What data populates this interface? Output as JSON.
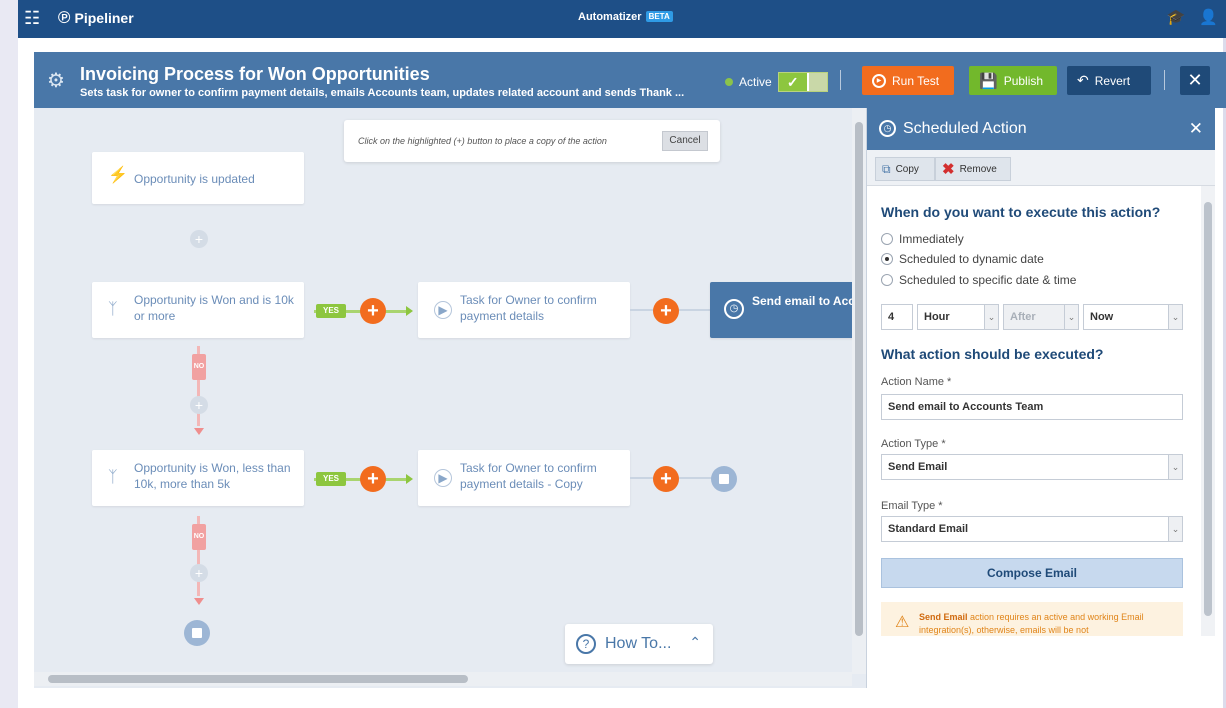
{
  "topbar": {
    "app_name": "Pipeliner",
    "module": "Automatizer",
    "beta_badge": "BETA"
  },
  "process": {
    "title": "Invoicing Process for Won Opportunities",
    "subtitle": "Sets task for owner to confirm payment details, emails Accounts team, updates related account and sends Thank ...",
    "status_label": "Active",
    "is_active": true,
    "run_test_label": "Run Test",
    "publish_label": "Publish",
    "revert_label": "Revert"
  },
  "canvas": {
    "hint_text": "Click on the highlighted (+) button to place a copy of the action",
    "cancel_label": "Cancel",
    "trigger_label": "Opportunity is updated",
    "yes_label": "YES",
    "no_label": "NO",
    "condition1_label": "Opportunity is Won and is 10k or more",
    "action1_label": "Task for Owner to confirm payment details",
    "action2_label": "Send email to Accounts Team",
    "condition2_label": "Opportunity is Won, less than 10k, more than 5k",
    "action3_label": "Task for Owner to confirm payment details - Copy",
    "howto_label": "How To..."
  },
  "panel": {
    "title": "Scheduled Action",
    "copy_label": "Copy",
    "remove_label": "Remove",
    "when_heading": "When do you want to execute this action?",
    "options": {
      "immediately": "Immediately",
      "dynamic": "Scheduled to dynamic date",
      "specific": "Scheduled to specific date & time"
    },
    "selected_option": "Scheduled to dynamic date",
    "schedule": {
      "amount": "4",
      "unit": "Hour",
      "relation": "After",
      "reference": "Now"
    },
    "what_heading": "What action should be executed?",
    "action_name_label": "Action Name *",
    "action_name_value": "Send email to Accounts Team",
    "action_type_label": "Action Type *",
    "action_type_value": "Send Email",
    "email_type_label": "Email Type *",
    "email_type_value": "Standard Email",
    "compose_label": "Compose Email",
    "warning_bold": "Send Email",
    "warning_text": " action requires an active and working Email integration(s), otherwise, emails will be not"
  },
  "colors": {
    "header_blue": "#1e4f87",
    "panel_blue": "#4977a8",
    "orange": "#f26c1e",
    "green": "#72b82c"
  }
}
